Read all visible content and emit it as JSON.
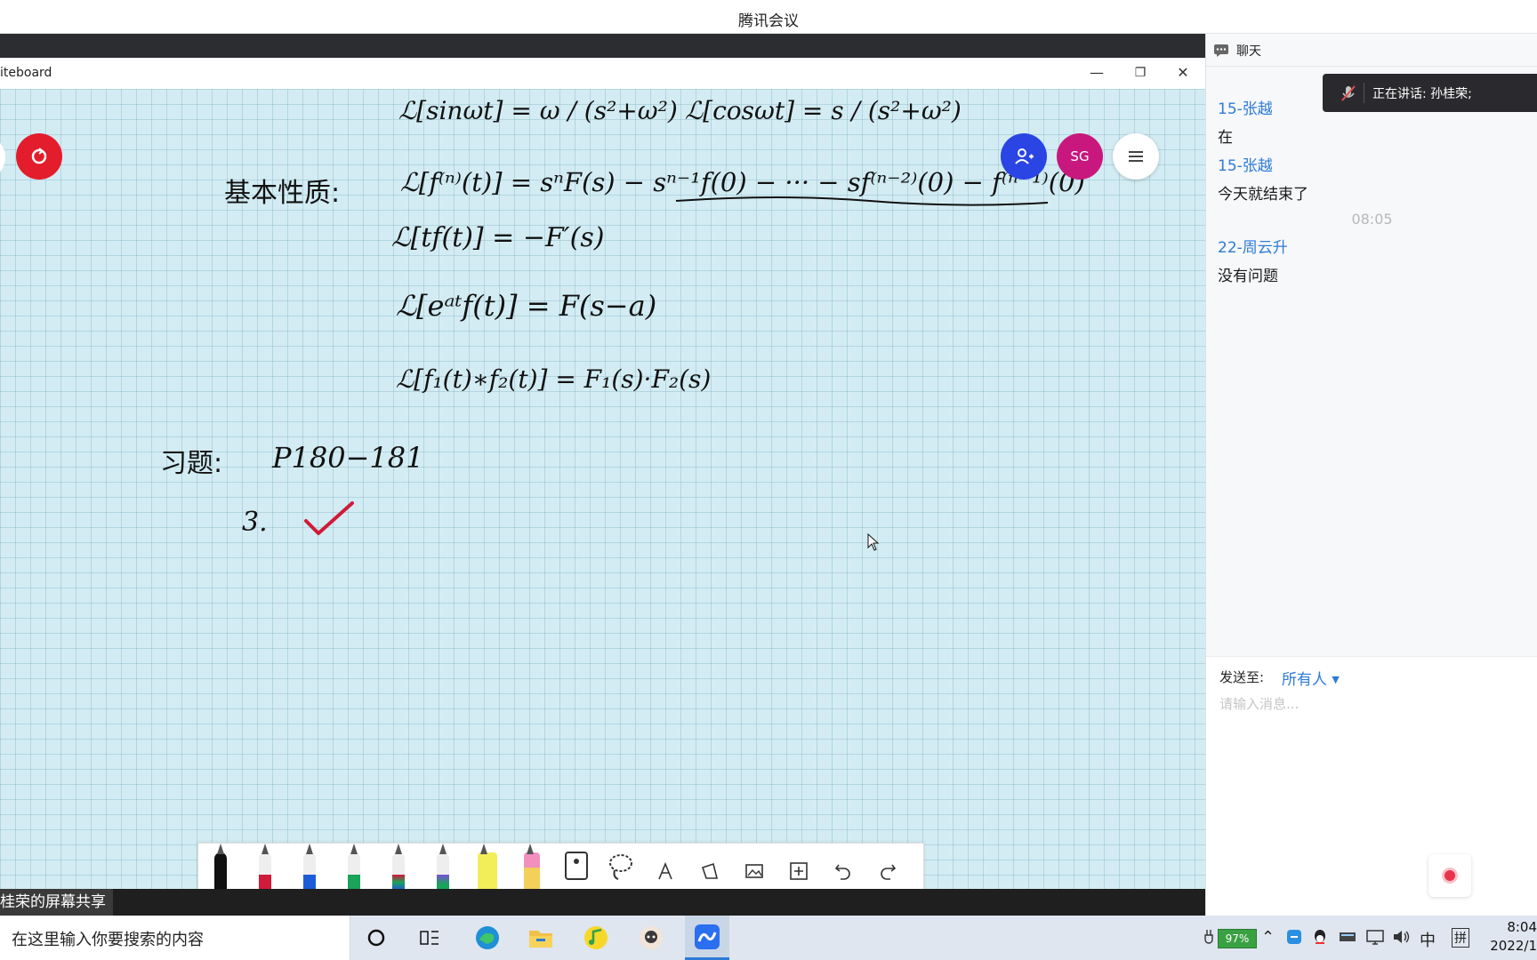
{
  "app": {
    "title": "腾讯会议"
  },
  "whiteboard": {
    "window_title": "iteboard",
    "minimize": "—",
    "restore": "❐",
    "close": "✕",
    "avatar_initials": "SG",
    "formulas": {
      "l_sin": "ℒ[sinωt] = ω / (s²+ω²)",
      "l_cos": "ℒ[cosωt] = s / (s²+ω²)",
      "props_label": "基本性质:",
      "deriv": "ℒ[f⁽ⁿ⁾(t)] = sⁿF(s) − sⁿ⁻¹f(0) − ··· − sf⁽ⁿ⁻²⁾(0) − f⁽ⁿ⁻¹⁾(0)",
      "tf": "ℒ[tf(t)] = −F′(s)",
      "shift": "ℒ[eᵃᵗf(t)] = F(s−a)",
      "conv": "ℒ[f₁(t)∗f₂(t)] = F₁(s)·F₂(s)",
      "hw_label": "习题:",
      "hw_pages": "P180−181",
      "hw_item": "3."
    },
    "share_label": "桂荣的屏幕共享"
  },
  "chat": {
    "header": "聊天",
    "speaking": "正在讲话: 孙桂荣;",
    "messages": [
      {
        "sender": "15-张越",
        "text": "在"
      },
      {
        "sender": "15-张越",
        "text": "今天就结束了"
      },
      {
        "sender": "22-周云升",
        "text": "没有问题"
      }
    ],
    "time": "08:05",
    "send_to_label": "发送至:",
    "send_to_value": "所有人",
    "input_placeholder": "请输入消息..."
  },
  "taskbar": {
    "search_placeholder": "在这里输入你要搜索的内容",
    "battery": "97%",
    "ime_lang": "中",
    "ime_mode": "拼",
    "time": "8:04",
    "date": "2022/1"
  }
}
